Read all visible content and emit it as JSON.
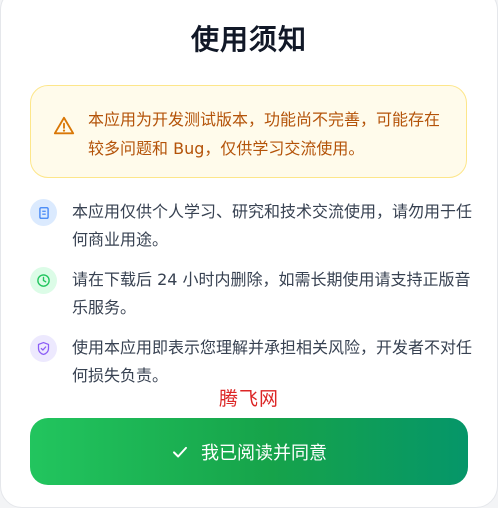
{
  "dialog": {
    "title": "使用须知",
    "warning": {
      "icon": "warning-triangle-icon",
      "text": "本应用为开发测试版本，功能尚不完善，可能存在较多问题和 Bug，仅供学习交流使用。"
    },
    "items": [
      {
        "icon": "document-icon",
        "color": "#3b82f6",
        "text": "本应用仅供个人学习、研究和技术交流使用，请勿用于任何商业用途。"
      },
      {
        "icon": "clock-icon",
        "color": "#22c55e",
        "text": "请在下载后 24 小时内删除，如需长期使用请支持正版音乐服务。"
      },
      {
        "icon": "shield-check-icon",
        "color": "#8b5cf6",
        "text": "使用本应用即表示您理解并承担相关风险，开发者不对任何损失负责。"
      }
    ],
    "watermark": "腾飞网",
    "confirm_button": {
      "icon": "checkmark-icon",
      "label": "我已阅读并同意"
    }
  },
  "colors": {
    "warning_text": "#b45309",
    "warning_bg": "#fffbeb",
    "accent_green": "#16a34a"
  }
}
